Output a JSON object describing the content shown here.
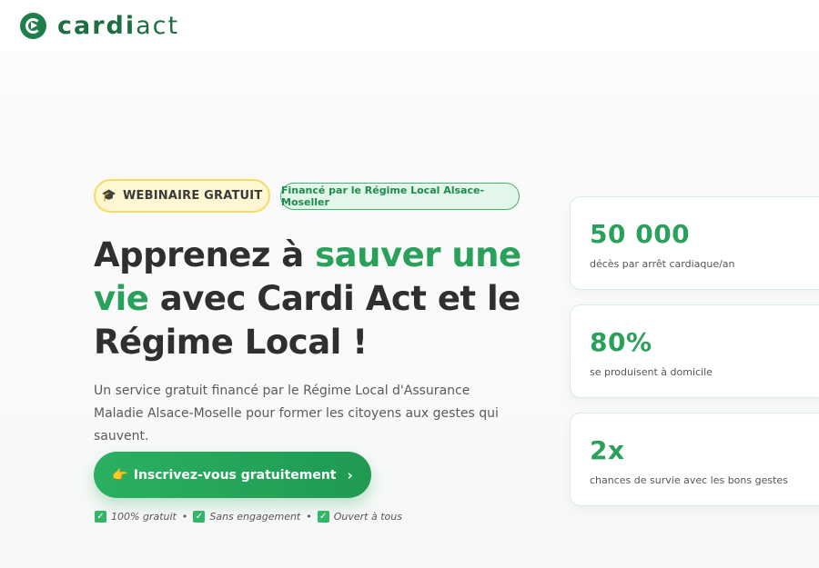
{
  "header": {
    "logo_bold": "cardi",
    "logo_light": "act",
    "logo_icon": "cardiact-logo-icon"
  },
  "hero": {
    "badge_webinar": {
      "icon": "🎓",
      "label": "WEBINAIRE GRATUIT"
    },
    "badge_funded": "Financé par le Régime Local Alsace-Moseller",
    "title_part1": "Apprenez à ",
    "title_accent1": "sauver une vie",
    "title_part2": " avec Cardi Act et le Régime Local !",
    "subtitle": "Un service gratuit financé par le Régime Local d'Assurance Maladie Alsace-Moselle pour former les citoyens aux gestes qui sauvent.",
    "cta": {
      "icon": "👉",
      "label": "Inscrivez-vous gratuitement",
      "chevron": "›"
    },
    "perks": [
      "100% gratuit",
      "Sans engagement",
      "Ouvert à tous"
    ],
    "perk_separator": "•"
  },
  "stats": [
    {
      "value": "50 000",
      "label": "décès par arrêt cardiaque/an"
    },
    {
      "value": "80%",
      "label": "se produisent à domicile"
    },
    {
      "value": "2x",
      "label": "chances de survie avec les bons gestes"
    }
  ],
  "colors": {
    "accent": "#2aa15b",
    "brand_dark": "#1e6e43",
    "badge_yellow": "#fff7d1",
    "badge_green": "#e3f6ea"
  }
}
